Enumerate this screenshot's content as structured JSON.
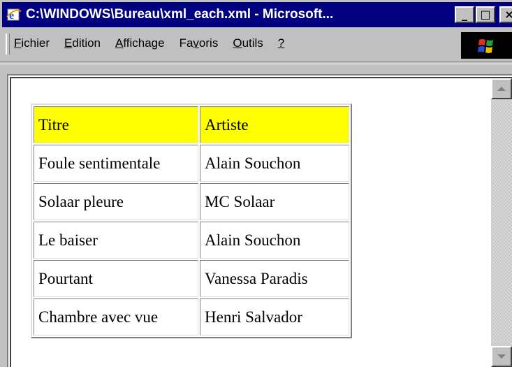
{
  "window": {
    "title": "C:\\WINDOWS\\Bureau\\xml_each.xml - Microsoft...",
    "buttons": {
      "minimize": "_",
      "maximize": "□",
      "close": "×"
    }
  },
  "menu": {
    "items": [
      {
        "label": "Fichier",
        "accel": "F",
        "rest": "ichier"
      },
      {
        "label": "Edition",
        "accel": "E",
        "rest": "dition"
      },
      {
        "label": "Affichage",
        "accel": "A",
        "rest": "ffichage"
      },
      {
        "label": "Favoris",
        "pre": "Fa",
        "accel": "v",
        "rest": "oris"
      },
      {
        "label": "Outils",
        "accel": "O",
        "rest": "utils"
      },
      {
        "label": "?",
        "accel": "?",
        "rest": ""
      }
    ]
  },
  "table": {
    "header": [
      "Titre",
      "Artiste"
    ],
    "rows": [
      [
        "Foule sentimentale",
        "Alain Souchon"
      ],
      [
        "Solaar pleure",
        "MC Solaar"
      ],
      [
        "Le baiser",
        "Alain Souchon"
      ],
      [
        "Pourtant",
        "Vanessa Paradis"
      ],
      [
        "Chambre avec vue",
        "Henri Salvador"
      ]
    ]
  },
  "colors": {
    "titlebar": "#000080",
    "header_bg": "#ffff00",
    "chrome": "#c0c0c0"
  }
}
